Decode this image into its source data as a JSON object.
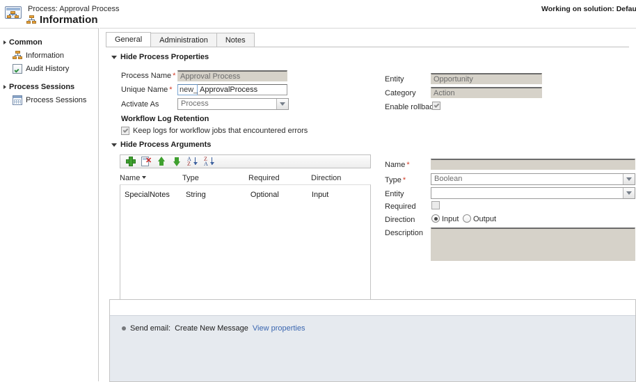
{
  "header": {
    "record_type_label": "Process: Approval Process",
    "page_title": "Information",
    "solution_status": "Working on solution: Default Sol"
  },
  "sidebar": {
    "groups": [
      {
        "title": "Common",
        "items": [
          {
            "label": "Information",
            "icon": "process-node-icon"
          },
          {
            "label": "Audit History",
            "icon": "audit-history-icon"
          }
        ]
      },
      {
        "title": "Process Sessions",
        "items": [
          {
            "label": "Process Sessions",
            "icon": "process-sessions-icon"
          }
        ]
      }
    ]
  },
  "tabs": [
    {
      "label": "General",
      "active": true
    },
    {
      "label": "Administration",
      "active": false
    },
    {
      "label": "Notes",
      "active": false
    }
  ],
  "process_properties": {
    "section_label": "Hide Process Properties",
    "process_name": {
      "label": "Process Name",
      "required": true,
      "value": "Approval Process"
    },
    "unique_name": {
      "label": "Unique Name",
      "required": true,
      "prefix": "new_",
      "value": "ApprovalProcess"
    },
    "activate_as": {
      "label": "Activate As",
      "required": false,
      "value": "Process"
    },
    "entity": {
      "label": "Entity",
      "required": false,
      "value": "Opportunity"
    },
    "category": {
      "label": "Category",
      "required": false,
      "value": "Action"
    },
    "enable_rollback": {
      "label": "Enable rollback",
      "checked": true
    },
    "workflow_log_retention": {
      "title": "Workflow Log Retention",
      "keep_logs": {
        "label": "Keep logs for workflow jobs that encountered errors",
        "checked": true
      }
    }
  },
  "process_arguments": {
    "section_label": "Hide Process Arguments",
    "toolbar": [
      {
        "name": "add-argument-button",
        "icon": "plus-icon"
      },
      {
        "name": "delete-argument-button",
        "icon": "delete-page-icon"
      },
      {
        "name": "move-up-button",
        "icon": "arrow-up-icon"
      },
      {
        "name": "move-down-button",
        "icon": "arrow-down-icon"
      },
      {
        "name": "sort-ascending-button",
        "icon": "sort-az-icon"
      },
      {
        "name": "sort-descending-button",
        "icon": "sort-za-icon"
      }
    ],
    "columns": [
      "Name",
      "Type",
      "Required",
      "Direction"
    ],
    "sorted_column": "Name",
    "rows": [
      {
        "name": "SpecialNotes",
        "type": "String",
        "required": "Optional",
        "direction": "Input"
      }
    ]
  },
  "argument_detail": {
    "name": {
      "label": "Name",
      "required": true,
      "value": ""
    },
    "type": {
      "label": "Type",
      "required": true,
      "value": "Boolean"
    },
    "entity": {
      "label": "Entity",
      "required": false,
      "value": ""
    },
    "required": {
      "label": "Required",
      "checked": false
    },
    "direction": {
      "label": "Direction",
      "options": [
        {
          "label": "Input",
          "selected": true
        },
        {
          "label": "Output",
          "selected": false
        }
      ]
    },
    "description": {
      "label": "Description",
      "value": ""
    }
  },
  "steps_panel": {
    "rows": [
      {
        "prefix": "Send email:",
        "action": "Create New Message",
        "link": "View properties"
      }
    ]
  },
  "colors": {
    "required_star": "#d23b26",
    "link": "#3a66b0",
    "field_bg": "#d6d2c9",
    "step_bg": "#e6eaef",
    "toolbar_green": "#3fa02f"
  }
}
